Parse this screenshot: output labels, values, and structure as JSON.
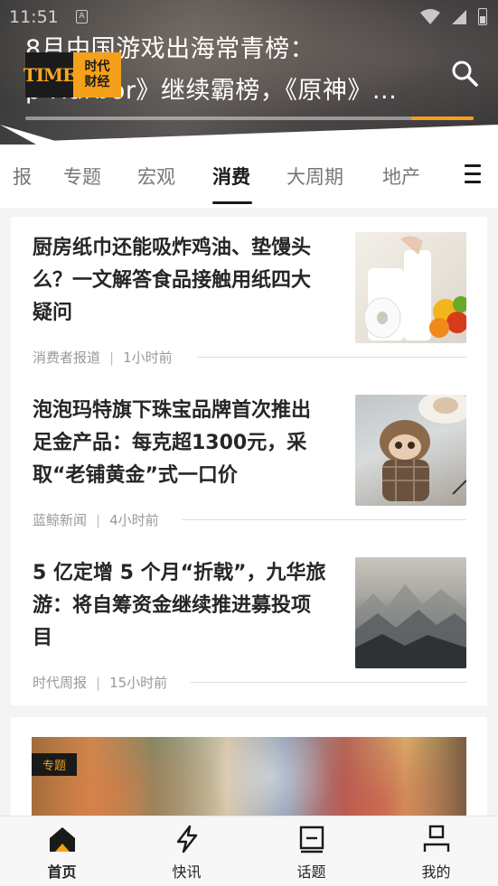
{
  "status_bar": {
    "time": "11:51",
    "sim_label": "A"
  },
  "header": {
    "headline_line1": "8月中国游戏出海常青榜：",
    "headline_line2": "p Harbor》继续霸榜，《原神》...",
    "logo": {
      "latin": "TIME",
      "cn_line1": "时代",
      "cn_line2": "财经"
    },
    "progress": 0.14,
    "accent_color": "#f5a01a"
  },
  "tabs": {
    "items": [
      {
        "label": "报"
      },
      {
        "label": "专题"
      },
      {
        "label": "宏观"
      },
      {
        "label": "消费"
      },
      {
        "label": "大周期"
      },
      {
        "label": "地产"
      }
    ],
    "active_index": 3,
    "menu_icon": "hamburger-icon"
  },
  "articles": [
    {
      "title": "厨房纸巾还能吸炸鸡油、垫馒头么？一文解答食品接触用纸四大疑问",
      "source": "消费者报道",
      "time": "1小时前",
      "thumb": "paper-towel-photo"
    },
    {
      "title": "泡泡玛特旗下珠宝品牌首次推出足金产品：每克超1300元，采取“老铺黄金”式一口价",
      "source": "蓝鲸新闻",
      "time": "4小时前",
      "thumb": "toy-photo"
    },
    {
      "title": "5 亿定增 5 个月“折戟”，九华旅游：将自筹资金继续推进募投项目",
      "source": "时代周报",
      "time": "15小时前",
      "thumb": "mountain-photo"
    }
  ],
  "feature_card": {
    "badge": "专题"
  },
  "bottom_nav": {
    "items": [
      {
        "label": "首页",
        "icon": "home-icon"
      },
      {
        "label": "快讯",
        "icon": "lightning-icon"
      },
      {
        "label": "话题",
        "icon": "topic-icon"
      },
      {
        "label": "我的",
        "icon": "profile-icon"
      }
    ],
    "active_index": 0
  }
}
